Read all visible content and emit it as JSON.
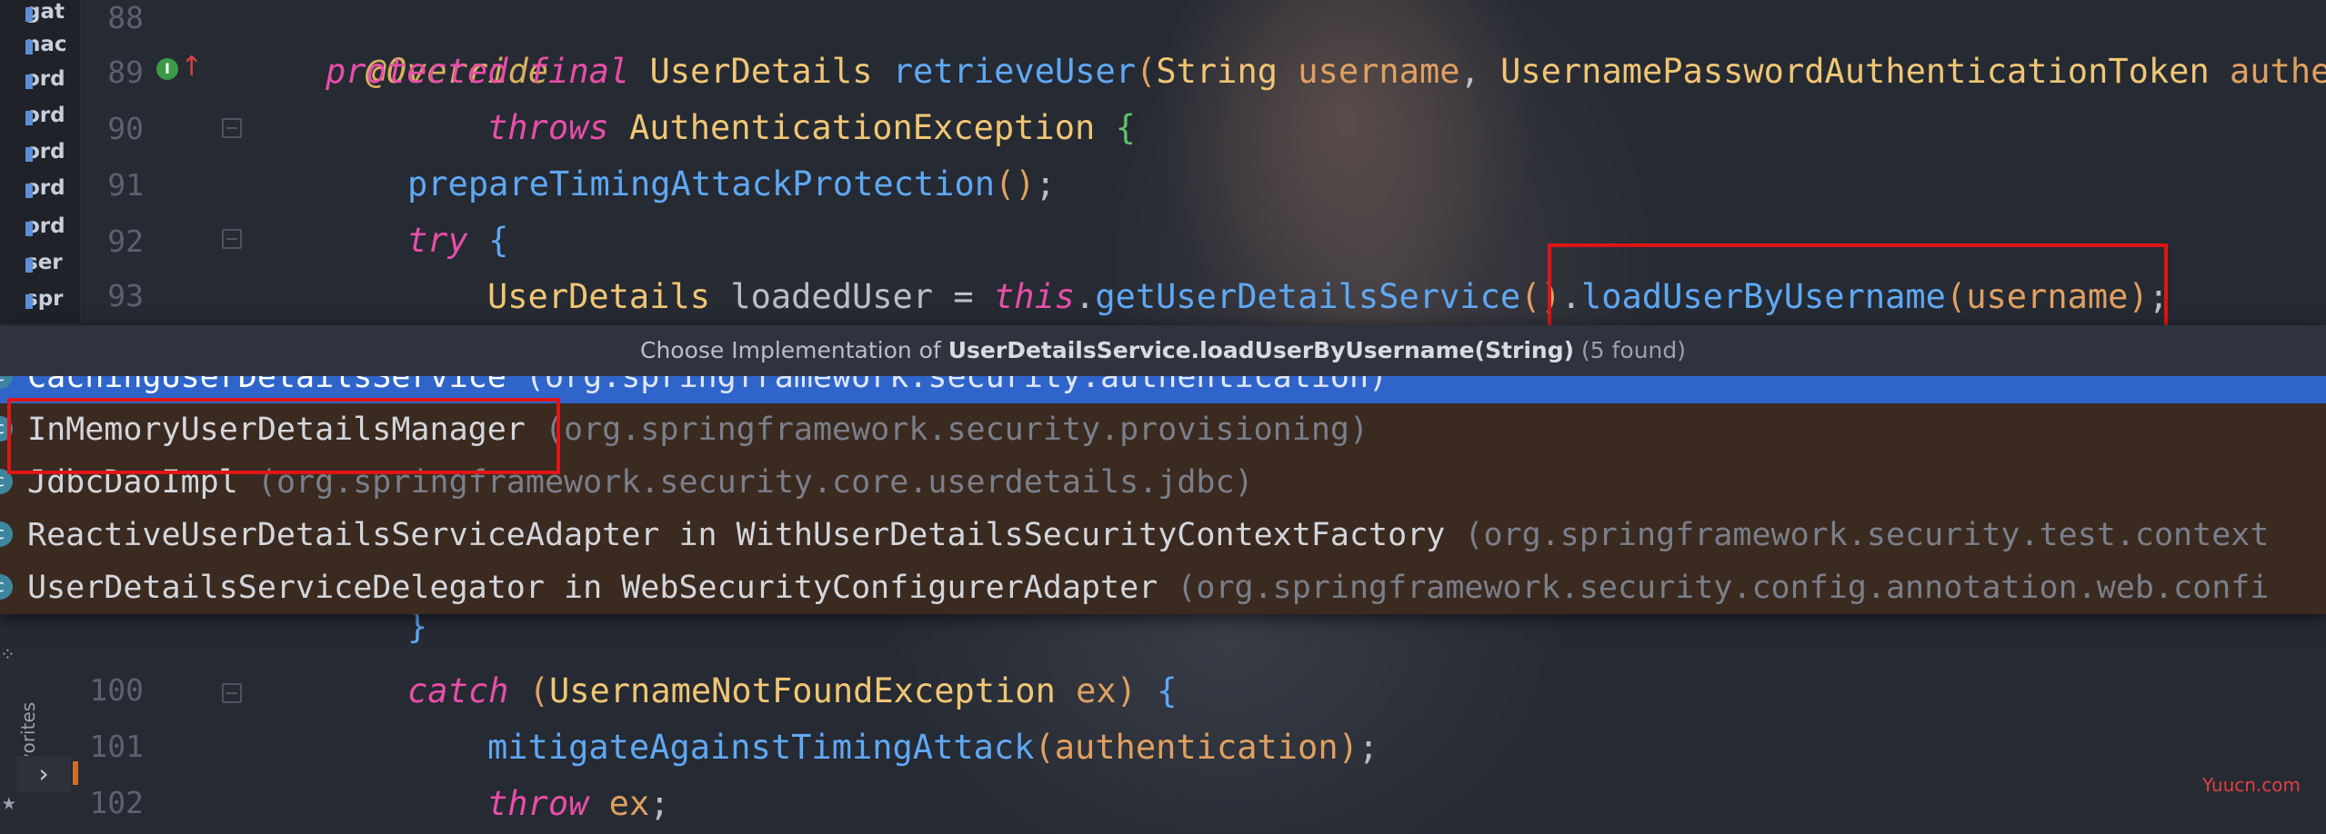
{
  "project_items": [
    "gat",
    "nac",
    "ord",
    "ord",
    "ord",
    "ord",
    "ord",
    "ser",
    "spr"
  ],
  "line_numbers": {
    "l88": "88",
    "l89": "89",
    "l90": "90",
    "l91": "91",
    "l92": "92",
    "l93": "93",
    "l100": "100",
    "l101": "101",
    "l102": "102"
  },
  "code": {
    "l88_annotation": "@Override",
    "l89_protected": "protected",
    "l89_final": "final",
    "l89_type": "UserDetails",
    "l89_method": "retrieveUser",
    "l89_open": "(",
    "l89_string": "String",
    "l89_username": "username",
    "l89_comma": ", ",
    "l89_token_type": "UsernamePasswordAuthenticationToken",
    "l89_authen": "authen",
    "l90_throws": "throws",
    "l90_exc": "AuthenticationException",
    "l90_brace": "{",
    "l91_call": "prepareTimingAttackProtection",
    "l91_parens": "()",
    "l91_semi": ";",
    "l92_try": "try",
    "l92_brace": "{",
    "l93_type": "UserDetails",
    "l93_var": "loadedUser",
    "l93_eq": "=",
    "l93_this": "this",
    "l93_dot1": ".",
    "l93_getter": "getUserDetailsService",
    "l93_parens": "()",
    "l93_dot2": ".",
    "l93_load": "loadUserByUsername",
    "l93_open": "(",
    "l93_arg": "username",
    "l93_close": ")",
    "l93_semi": ";",
    "l99_brace": "}",
    "l100_catch": "catch",
    "l100_open": "(",
    "l100_exc": "UsernameNotFoundException",
    "l100_ex": "ex",
    "l100_close": ")",
    "l100_brace": "{",
    "l101_call": "mitigateAgainstTimingAttack",
    "l101_open": "(",
    "l101_arg": "authentication",
    "l101_close": ")",
    "l101_semi": ";",
    "l102_throw": "throw",
    "l102_ex": "ex",
    "l102_semi": ";"
  },
  "popup": {
    "header_prefix": "Choose Implementation of ",
    "header_bold": "UserDetailsService.loadUserByUsername(String)",
    "header_count": "(5 found)",
    "items": [
      {
        "name": "CachingUserDetailsService",
        "pkg": "(org.springframework.security.authentication)"
      },
      {
        "name": "InMemoryUserDetailsManager",
        "pkg": "(org.springframework.security.provisioning)"
      },
      {
        "name": "JdbcDaoImpl",
        "pkg": "(org.springframework.security.core.userdetails.jdbc)"
      },
      {
        "name": "ReactiveUserDetailsServiceAdapter in WithUserDetailsSecurityContextFactory",
        "pkg": "(org.springframework.security.test.context"
      },
      {
        "name": "UserDetailsServiceDelegator in WebSecurityConfigurerAdapter",
        "pkg": "(org.springframework.security.config.annotation.web.confi"
      }
    ]
  },
  "sidebar": {
    "favorites_label": "Favorites"
  },
  "icons": {
    "class_icon": "c",
    "override_icon": "I",
    "up_arrow": "↑",
    "star": "★",
    "chevron": "›",
    "grid": "⁘"
  },
  "watermark": "Yuucn.com",
  "colors": {
    "selection": "#2f65ca",
    "highlight_box": "#e01515",
    "keyword": "#e84ea8",
    "function": "#5fa8f3"
  }
}
